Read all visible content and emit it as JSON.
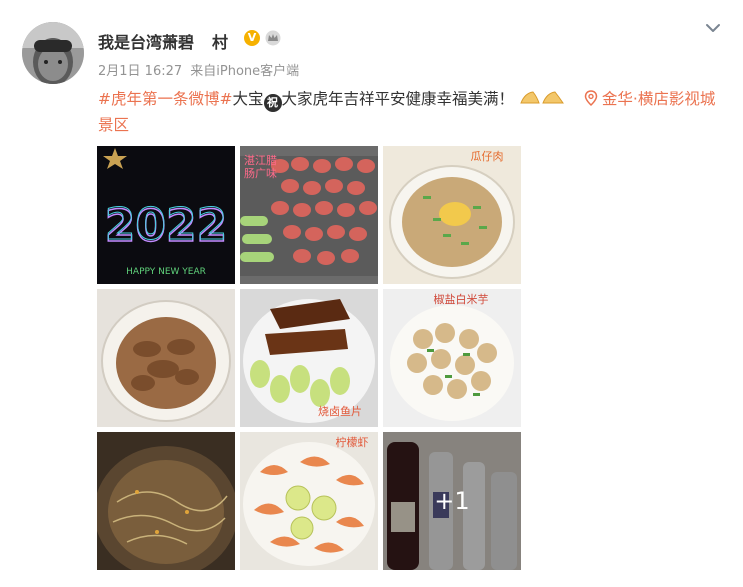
{
  "post": {
    "user": {
      "name": "我是台湾萧碧",
      "name_suffix": "村"
    },
    "verified_badge": "V",
    "meta": {
      "time": "2月1日 16:27",
      "source": "来自iPhone客户端"
    },
    "text": {
      "hashtag_1": "#虎年第一条微博#",
      "part_1": "大宝",
      "emoji_label": "祝",
      "part_2": "大家虎年吉祥平安健康幸福美满！",
      "location": "金华·横店影视城景区"
    },
    "images": {
      "img1_caption": "HAPPY NEW YEAR",
      "img1_year": "2022",
      "img2_note": "湛江腊\n肠广味",
      "img3_note": "瓜仔肉",
      "img5_note": "烧卤鱼片",
      "img6_note": "椒盐白米芋",
      "img8_note": "柠檬虾",
      "more_count": "+1"
    },
    "colors": {
      "link": "#eb7350",
      "meta": "#939393",
      "badge": "#f6b100"
    },
    "icons": [
      "chevron-down-icon",
      "location-pin-icon",
      "verified-badge-icon",
      "crown-icon"
    ]
  }
}
